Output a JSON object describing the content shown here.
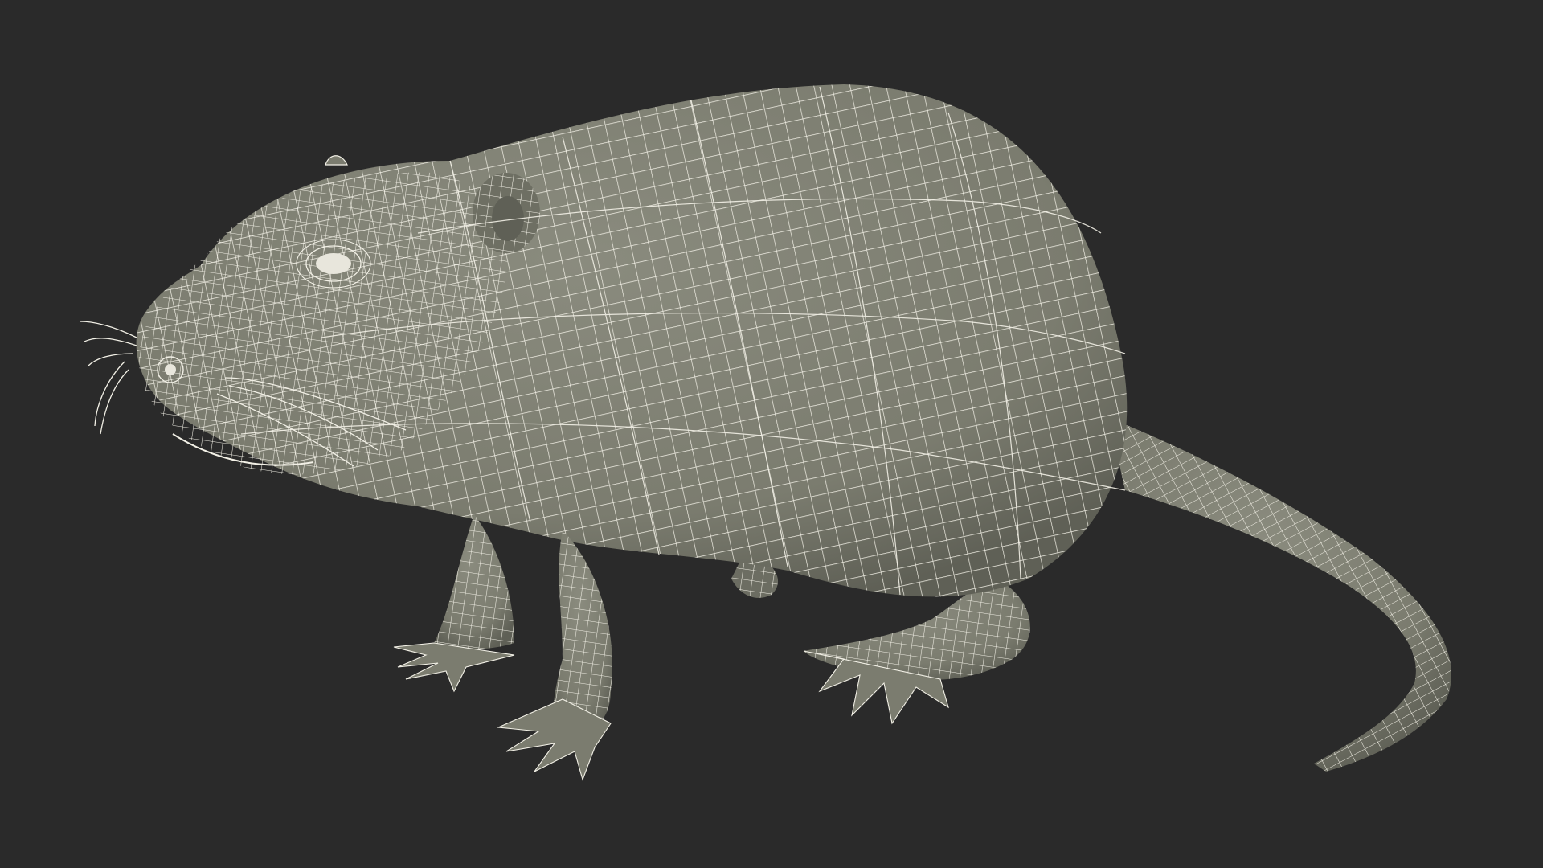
{
  "scene": {
    "subject": "rodent-wireframe-model",
    "colors": {
      "background": "#2a2a2a",
      "surface": "#7b7c6f",
      "surface_light": "#8a8b7e",
      "surface_dark": "#5f6056",
      "wire": "#f2f0e6",
      "eye": "#e8e6dc"
    },
    "wireframe": {
      "visible": true,
      "density": "high"
    }
  }
}
